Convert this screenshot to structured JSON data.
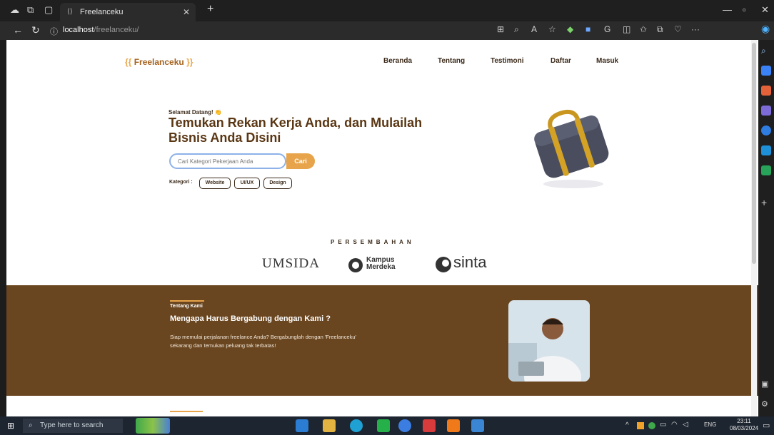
{
  "browser": {
    "tab_title": "Freelanceku",
    "url_host": "localhost",
    "url_path": "/freelanceku/"
  },
  "site": {
    "logo_open": "{{",
    "logo_text": "Freelanceku",
    "logo_close": "}}",
    "nav": [
      "Beranda",
      "Tentang",
      "Testimoni",
      "Daftar",
      "Masuk"
    ]
  },
  "hero": {
    "greeting": "Selamat Datang! 👏",
    "title": "Temukan Rekan Kerja Anda, dan Mulailah Bisnis Anda Disini",
    "search_placeholder": "Cari Kategori Pekerjaan Anda",
    "search_button": "Cari",
    "category_label": "Kategori :",
    "categories": [
      "Website",
      "UI/UX",
      "Design"
    ]
  },
  "partners": {
    "heading": "PERSEMBAHAN",
    "logos": [
      "UMSIDA",
      "Kampus Merdeka",
      "sinta"
    ]
  },
  "about": {
    "kicker": "Tentang Kami",
    "title": "Mengapa Harus Bergabung dengan Kami ?",
    "body": "Siap memulai perjalanan freelance Anda? Bergabunglah dengan 'Freelanceku' sekarang dan temukan peluang tak terbatas!"
  },
  "taskbar": {
    "search_placeholder": "Type here to search",
    "lang": "ENG",
    "time": "23:11",
    "date": "08/03/2024"
  },
  "colors": {
    "brand_brown": "#6a4620",
    "accent_orange": "#e8a44a",
    "heading_brown": "#5a3714"
  }
}
